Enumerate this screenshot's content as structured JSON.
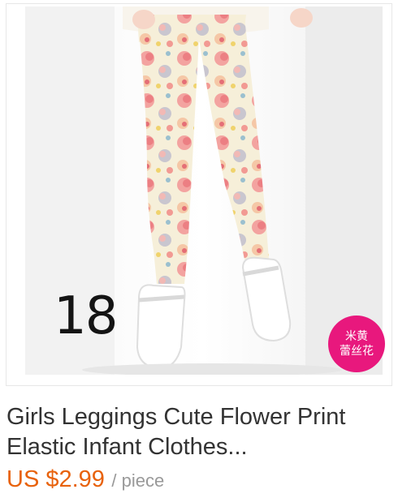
{
  "product": {
    "image_alt": "Girls floral print leggings with white shoes",
    "number_label": "18",
    "color_badge": {
      "line1": "米黄",
      "line2": "蕾丝花"
    },
    "title_line1": "Girls Leggings Cute Flower Print",
    "title_line2": "Elastic Infant Clothes...",
    "price": "US $2.99",
    "unit": "/ piece"
  },
  "colors": {
    "price": "#e8620c",
    "badge": "#e8187d",
    "title": "#333333",
    "unit": "#999999"
  }
}
